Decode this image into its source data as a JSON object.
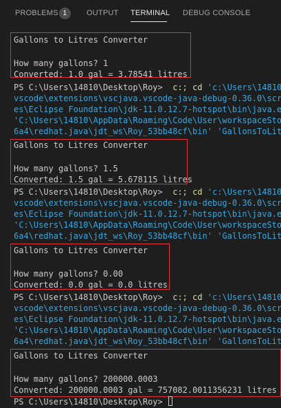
{
  "panel_tabs": {
    "problems": "PROBLEMS",
    "problems_count": "1",
    "output": "OUTPUT",
    "terminal": "TERMINAL",
    "debug_console": "DEBUG CONSOLE"
  },
  "colors": {
    "highlight_box": "#e1303a",
    "path_string": "#3ba7dc",
    "command": "#dcdcaa"
  },
  "terminal": {
    "runs": [
      {
        "title": "Gallons to Litres Converter",
        "question": "How many gallons? 1",
        "result": "Converted: 1.0 gal = 3.78541 litres"
      },
      {
        "title": "Gallons to Litres Converter",
        "question": "How many gallons? 1.5",
        "result": "Converted: 1.5 gal = 5.678115 litres"
      },
      {
        "title": "Gallons to Litres Converter",
        "question": "How many gallons? 0.00",
        "result": "Converted: 0.0 gal = 0.0 litres"
      },
      {
        "title": "Gallons to Litres Converter",
        "question": "How many gallons? 200000.0003",
        "result": "Converted: 200000.0003 gal = 757082.0011356231 litres"
      }
    ],
    "prompt": "PS C:\\Users\\14810\\Desktop\\Roy>",
    "cmd_keyword": "c:; cd",
    "cmd_path_start": "'c:\\Users\\14810\\D",
    "wrap_lines": [
      "vscode\\extensions\\vscjava.vscode-java-debug-0.36.0\\scrip",
      "es\\Eclipse Foundation\\jdk-11.0.12.7-hotspot\\bin\\java.exe",
      "'C:\\Users\\14810\\AppData\\Roaming\\Code\\User\\workspaceStora",
      "6a4\\redhat.java\\jdt_ws\\Roy_53bb48cf\\bin' 'GallonsToLitre"
    ],
    "wrap_lines_first": [
      "vscode\\extensions\\vscjava.vscode-java-debug-0.36.0\\scrip",
      "es\\Eclipse Foundation\\jdk-11.0.12.7-hotspot\\bin\\java.exe",
      "'C:\\Users\\14810\\AppData\\Roaming\\Code\\User\\workspaceStora",
      "6a4\\redhat.java\\jdt_ws\\Roy_53bb48cf\\bin' 'GallonsToLitr"
    ]
  }
}
